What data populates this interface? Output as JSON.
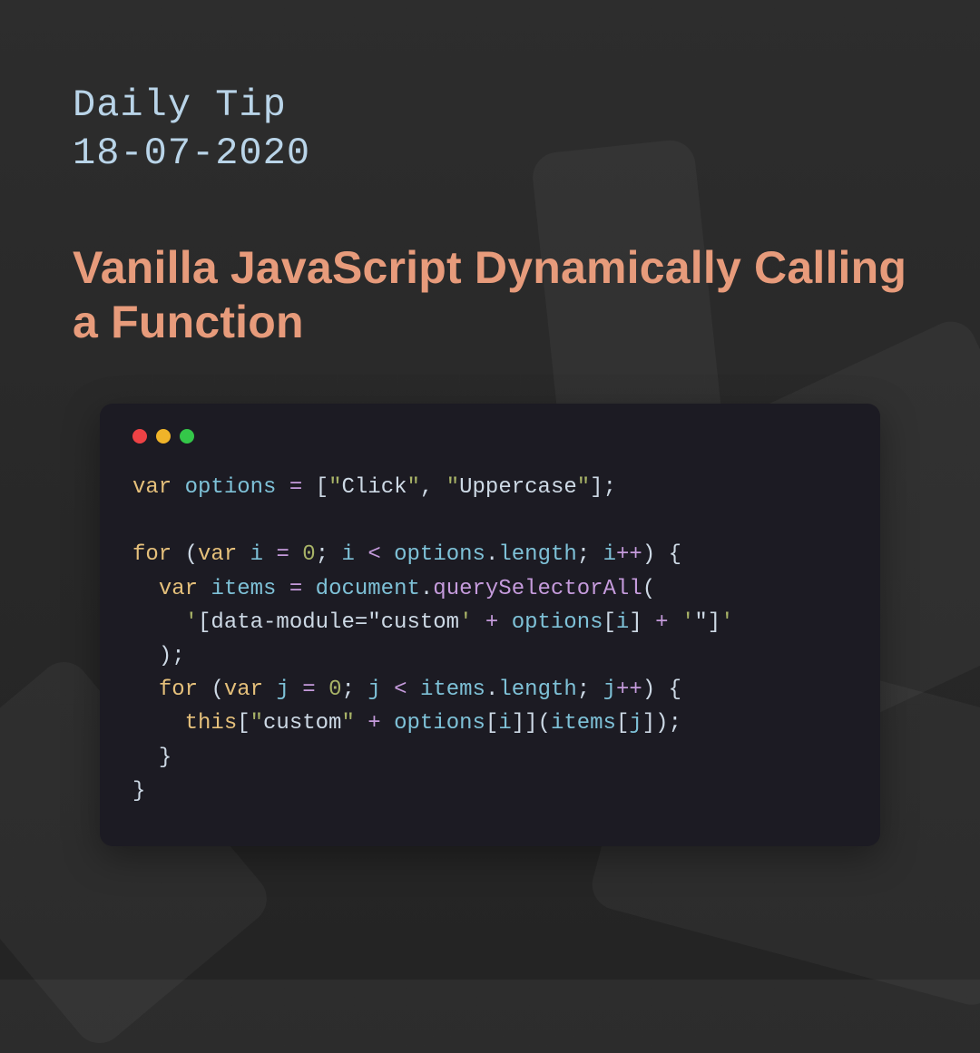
{
  "kicker_line1": "Daily Tip",
  "kicker_line2": "18-07-2020",
  "title": "Vanilla JavaScript Dynamically Calling a Function",
  "code": {
    "l1": {
      "kw": "var",
      "id": "options",
      "op": "=",
      "arr_open": "[",
      "q1": "\"",
      "s1": "Click",
      "q2": "\"",
      "comma": ",",
      "q3": "\"",
      "s2": "Uppercase",
      "q4": "\"",
      "arr_close": "]",
      "semi": ";"
    },
    "l2": {},
    "l3": {
      "kw": "for",
      "po": "(",
      "kw2": "var",
      "id": "i",
      "op": "=",
      "num": "0",
      "semi": ";",
      "id2": "i",
      "op2": "<",
      "obj": "options",
      "dot": ".",
      "prop": "length",
      "semi2": ";",
      "id3": "i",
      "op3": "++",
      "pc": ")",
      "brace": "{"
    },
    "l4": {
      "indent": "  ",
      "kw": "var",
      "id": "items",
      "op": "=",
      "obj": "document",
      "dot": ".",
      "fn": "querySelectorAll",
      "po": "("
    },
    "l5": {
      "indent": "    ",
      "q1": "'",
      "s1": "[data-module=\"custom",
      "q2": "'",
      "op": "+",
      "id": "options",
      "br1": "[",
      "id2": "i",
      "br2": "]",
      "op2": "+",
      "q3": "'",
      "s2": "\"]",
      "q4": "'"
    },
    "l6": {
      "indent": "  ",
      "pc": ")",
      "semi": ";"
    },
    "l7": {
      "indent": "  ",
      "kw": "for",
      "po": "(",
      "kw2": "var",
      "id": "j",
      "op": "=",
      "num": "0",
      "semi": ";",
      "id2": "j",
      "op2": "<",
      "obj": "items",
      "dot": ".",
      "prop": "length",
      "semi2": ";",
      "id3": "j",
      "op3": "++",
      "pc": ")",
      "brace": "{"
    },
    "l8": {
      "indent": "    ",
      "kw": "this",
      "br1": "[",
      "q1": "\"",
      "s1": "custom",
      "q2": "\"",
      "op": "+",
      "id": "options",
      "br2": "[",
      "id2": "i",
      "br3": "]",
      "br4": "]",
      "po": "(",
      "id3": "items",
      "br5": "[",
      "id4": "j",
      "br6": "]",
      "pc": ")",
      "semi": ";"
    },
    "l9": {
      "indent": "  ",
      "brace": "}"
    },
    "l10": {
      "brace": "}"
    }
  },
  "colors": {
    "bg_top": "#2d2d2d",
    "bg_bottom": "#242424",
    "kicker": "#b9d4e8",
    "title": "#e79b7b",
    "code_bg": "#1c1b23",
    "dot_red": "#ed4245",
    "dot_yellow": "#f0b429",
    "dot_green": "#34c749"
  }
}
